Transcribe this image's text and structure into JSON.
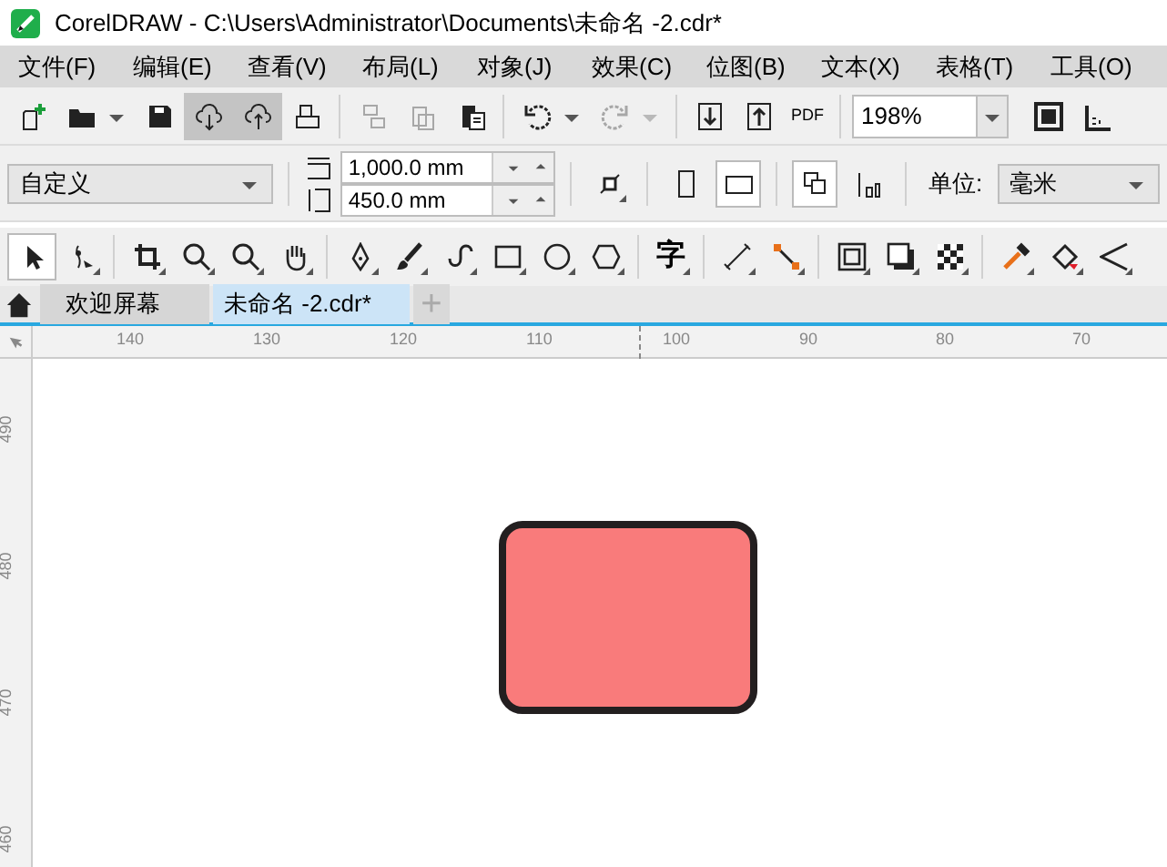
{
  "window": {
    "title": "CorelDRAW - C:\\Users\\Administrator\\Documents\\未命名 -2.cdr*"
  },
  "menu": [
    "文件(F)",
    "编辑(E)",
    "查看(V)",
    "布局(L)",
    "对象(J)",
    "效果(C)",
    "位图(B)",
    "文本(X)",
    "表格(T)",
    "工具(O)"
  ],
  "standard_toolbar": {
    "buttons": [
      {
        "selected": false,
        "disabled": false
      },
      {
        "selected": false,
        "disabled": false
      },
      {
        "selected": false,
        "disabled": false
      },
      {
        "selected": true,
        "disabled": false
      },
      {
        "selected": true,
        "disabled": false
      },
      {
        "selected": false,
        "disabled": false
      },
      {
        "selected": false,
        "disabled": true
      },
      {
        "selected": false,
        "disabled": true
      },
      {
        "selected": false,
        "disabled": false
      },
      {
        "selected": false,
        "disabled": false
      },
      {
        "selected": false,
        "disabled": true
      },
      {
        "selected": false,
        "disabled": false
      },
      {
        "selected": false,
        "disabled": false
      }
    ],
    "pdf_label": "PDF",
    "zoom": "198%"
  },
  "property_bar": {
    "page_size": "自定义",
    "width": "1,000.0 mm",
    "height": "450.0 mm",
    "orientation_landscape": true,
    "units_label": "单位:",
    "units": "毫米"
  },
  "toolbox": {
    "pick_tool_selected": true,
    "text_tool": "字"
  },
  "tabs": [
    {
      "label": "欢迎屏幕",
      "selected": false
    },
    {
      "label": "未命名 -2.cdr*",
      "selected": true
    }
  ],
  "new_tab": "+",
  "ruler_h": [
    "140",
    "130",
    "120",
    "110",
    "100",
    "90",
    "80",
    "70"
  ],
  "ruler_v": [
    "490",
    "480",
    "470",
    "460"
  ]
}
